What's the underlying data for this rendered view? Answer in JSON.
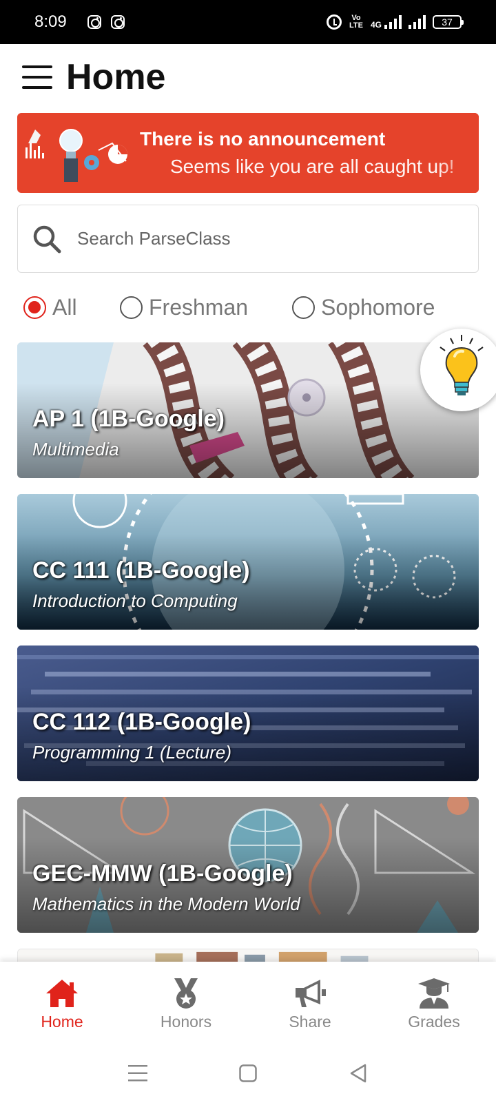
{
  "status_bar": {
    "time": "8:09",
    "network": "4G",
    "volte": "Vo LTE",
    "battery": "37"
  },
  "header": {
    "title": "Home"
  },
  "announcement": {
    "title": "There is no announcement",
    "subtitle": "Seems like you are all caught up!",
    "background_color": "#e5432b"
  },
  "search": {
    "placeholder": "Search ParseClass"
  },
  "filters": {
    "options": [
      {
        "label": "All",
        "selected": true
      },
      {
        "label": "Freshman",
        "selected": false
      },
      {
        "label": "Sophomore",
        "selected": false
      }
    ],
    "accent_color": "#e0231b"
  },
  "courses": [
    {
      "code": "AP 1 (1B-Google)",
      "name": "Multimedia"
    },
    {
      "code": "CC 111 (1B-Google)",
      "name": "Introduction to Computing"
    },
    {
      "code": "CC 112 (1B-Google)",
      "name": "Programming 1 (Lecture)"
    },
    {
      "code": "GEC-MMW (1B-Google)",
      "name": "Mathematics in the Modern World"
    }
  ],
  "bottom_nav": {
    "items": [
      {
        "label": "Home",
        "icon": "home-icon",
        "active": true
      },
      {
        "label": "Honors",
        "icon": "medal-icon",
        "active": false
      },
      {
        "label": "Share",
        "icon": "megaphone-icon",
        "active": false
      },
      {
        "label": "Grades",
        "icon": "graduate-icon",
        "active": false
      }
    ],
    "active_color": "#e0231b"
  }
}
